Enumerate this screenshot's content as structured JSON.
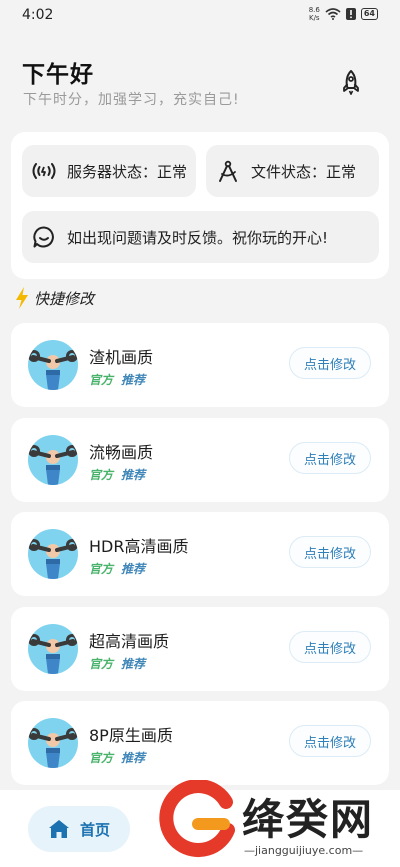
{
  "status_bar": {
    "time": "4:02",
    "net_speed_value": "8.6",
    "net_speed_unit": "K/s",
    "battery": "64"
  },
  "greeting": {
    "title": "下午好",
    "subtitle": "下午时分，加强学习，充实自己!"
  },
  "info": {
    "server_status": "服务器状态：正常",
    "file_status": "文件状态：正常",
    "notice": "如出现问题请及时反馈。祝你玩的开心!"
  },
  "section": {
    "title": "快捷修改"
  },
  "quality_items": [
    {
      "title": "渣机画质",
      "tag1": "官方",
      "tag2": "推荐",
      "button": "点击修改"
    },
    {
      "title": "流畅画质",
      "tag1": "官方",
      "tag2": "推荐",
      "button": "点击修改"
    },
    {
      "title": "HDR高清画质",
      "tag1": "官方",
      "tag2": "推荐",
      "button": "点击修改"
    },
    {
      "title": "超高清画质",
      "tag1": "官方",
      "tag2": "推荐",
      "button": "点击修改"
    },
    {
      "title": "8P原生画质",
      "tag1": "官方",
      "tag2": "推荐",
      "button": "点击修改"
    }
  ],
  "nav": {
    "home_label": "首页"
  },
  "watermark": {
    "text": "绛癸网",
    "url": "—jiangguijiuye.com—"
  },
  "icons": {
    "rocket": "rocket-icon",
    "server": "broadcast-icon",
    "file": "compass-icon",
    "notice": "chat-icon",
    "lightning": "lightning-icon",
    "tool": "wrench-icon",
    "home": "home-icon"
  },
  "colors": {
    "accent_blue": "#2f7fb8",
    "tag_green": "#49b36b",
    "tag_blue": "#3f86b8",
    "avatar_bg": "#7fd3ef",
    "lightning": "#f5b800"
  }
}
